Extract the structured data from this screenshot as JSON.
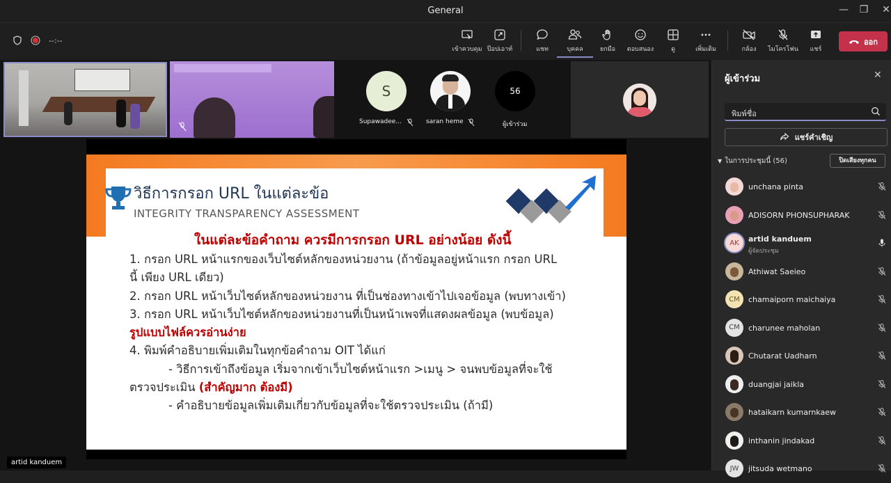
{
  "window": {
    "title": "General"
  },
  "toolbar": {
    "timer": "--:--",
    "buttons": [
      {
        "label": "เข้าควบคุม"
      },
      {
        "label": "ป๊อปเอาท์"
      },
      {
        "label": "แชท"
      },
      {
        "label": "บุคคล"
      },
      {
        "label": "ยกมือ"
      },
      {
        "label": "ตอบสนอง"
      },
      {
        "label": "ดู"
      },
      {
        "label": "เพิ่มเติม"
      },
      {
        "label": "กล้อง"
      },
      {
        "label": "ไมโครโฟน"
      },
      {
        "label": "แชร์"
      }
    ],
    "leave_label": "ออก",
    "accent": "#8b8cc7",
    "leave_color": "#c4314b"
  },
  "stage": {
    "tiles": [
      {
        "name": "Supawadee...",
        "initial": "S"
      },
      {
        "name": "saran heme"
      },
      {
        "name": "ผู้เข้าร่วม",
        "count": "56"
      }
    ],
    "self_name": "artid kanduem"
  },
  "slide": {
    "title": "วิธีการกรอก URL ในแต่ละข้อ",
    "subtitle": "INTEGRITY TRANSPARENCY ASSESSMENT",
    "headline": "ในแต่ละข้อคำถาม ควรมีการกรอก URL อย่างน้อย ดังนี้",
    "lines": [
      "1. กรอก URL หน้าแรกของเว็บไซต์หลักของหน่วยงาน (ถ้าข้อมูลอยู่หน้าแรก กรอก URL",
      "นี้ เพียง URL เดียว)",
      "2. กรอก URL หน้าเว็บไซต์หลักของหน่วยงาน ที่เป็นช่องทางเข้าไปเจอข้อมูล   (พบทางเข้า)",
      "3. กรอก URL หน้าเว็บไซต์หลักของหน่วยงานที่เป็นหน้าเพจที่แสดงผลข้อมูล   (พบข้อมูล)",
      "รูปแบบไฟล์ควรอ่านง่าย",
      "4. พิมพ์คำอธิบายเพิ่มเติมในทุกข้อคำถาม OIT ได้แก่",
      "- วิธีการเข้าถึงข้อมูล เริ่มจากเข้าเว็บไซต์หน้าแรก >เมนู > จนพบข้อมูลที่จะใช้",
      "ตรวจประเมิน ",
      "(สำคัญมาก ต้องมี)",
      "- คำอธิบายข้อมูลเพิ่มเติมเกี่ยวกับข้อมูลที่จะใช้ตรวจประเมิน (ถ้ามี)"
    ]
  },
  "panel": {
    "title": "ผู้เข้าร่วม",
    "search_placeholder": "พิมพ์ชื่อ",
    "share_invite": "แชร์คำเชิญ",
    "section": "ในการประชุมนี้ (56)",
    "mute_all": "ปิดเสียงทุกคน",
    "participants": [
      {
        "name": "unchana pinta",
        "mic": "muted"
      },
      {
        "name": "ADISORN PHONSUPHARAK",
        "mic": "muted"
      },
      {
        "name": "artid kanduem",
        "role": "ผู้จัดประชุม",
        "initials": "AK",
        "mic": "on"
      },
      {
        "name": "Athiwat Saeieo",
        "mic": "muted"
      },
      {
        "name": "chamaiporn maichaiya",
        "initials": "CM",
        "mic": "muted"
      },
      {
        "name": "charunee maholan",
        "initials": "CM",
        "mic": "muted"
      },
      {
        "name": "Chutarat Uadharn",
        "mic": "muted"
      },
      {
        "name": "duangjai jaikla",
        "mic": "muted"
      },
      {
        "name": "hataikarn kumarnkaew",
        "mic": "muted"
      },
      {
        "name": "inthanin jindakad",
        "mic": "muted"
      },
      {
        "name": "jitsuda wetmano",
        "initials": "JW",
        "mic": "muted"
      }
    ]
  }
}
